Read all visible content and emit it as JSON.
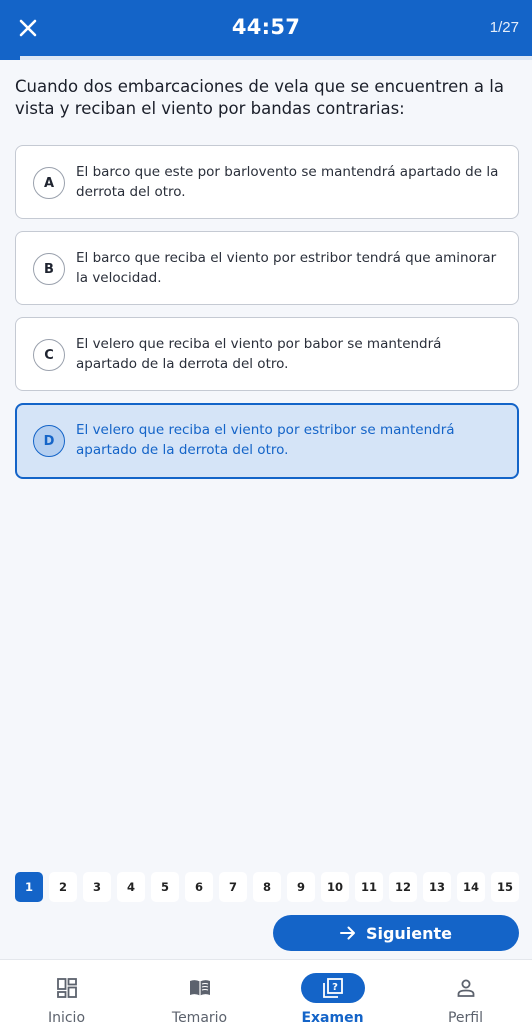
{
  "header": {
    "timer": "44:57",
    "counter": "1/27",
    "close_icon": "close-icon",
    "progress_fraction": 0.037
  },
  "question": {
    "text": "Cuando dos embarcaciones de vela que se encuentren a la vista y reciban el viento por bandas contrarias:"
  },
  "options": [
    {
      "letter": "A",
      "text": "El barco que este por barlovento se mantendrá apartado de la derrota del otro."
    },
    {
      "letter": "B",
      "text": "El barco que reciba el viento por estribor tendrá que aminorar la velocidad."
    },
    {
      "letter": "C",
      "text": "El velero que reciba el viento por babor se mantendrá apartado de la derrota del otro."
    },
    {
      "letter": "D",
      "text": "El velero que reciba el viento por estribor se mantendrá apartado de la derrota del otro.",
      "selected": true
    }
  ],
  "pager": {
    "pages": [
      "1",
      "2",
      "3",
      "4",
      "5",
      "6",
      "7",
      "8",
      "9",
      "10",
      "11",
      "12",
      "13",
      "14",
      "15"
    ],
    "current": "1"
  },
  "next_button": {
    "label": "Siguiente",
    "icon": "arrow-right-icon"
  },
  "bottom_nav": [
    {
      "label": "Inicio",
      "icon": "dashboard-icon"
    },
    {
      "label": "Temario",
      "icon": "book-icon"
    },
    {
      "label": "Examen",
      "icon": "quiz-icon",
      "active": true
    },
    {
      "label": "Perfil",
      "icon": "person-icon"
    }
  ],
  "colors": {
    "primary": "#1464c8",
    "selected_bg": "#d5e4f7",
    "background": "#f5f7fb"
  }
}
